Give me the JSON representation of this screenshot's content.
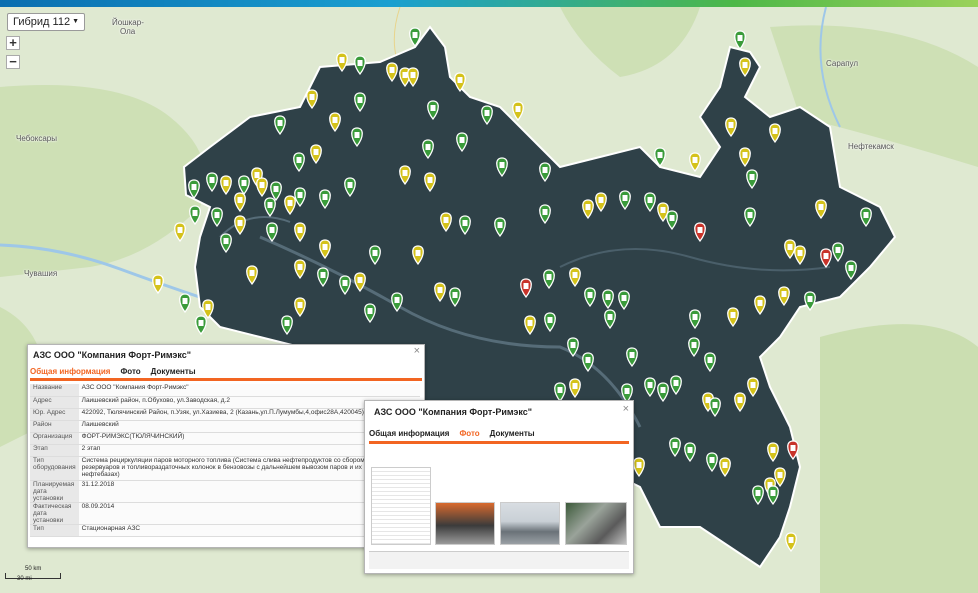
{
  "map": {
    "layer_select": "Гибрид 112",
    "zoom_in": "+",
    "zoom_out": "−",
    "labels": {
      "cheboksary": "Чебоксары",
      "yoshkar_ola_1": "Йошкар-",
      "yoshkar_ola_2": "Ола",
      "sarapul": "Сарапул",
      "neftekamsk": "Нефтекамск",
      "chuvashia": "Чувашия"
    },
    "scale": {
      "km": "50 km",
      "mi": "30 mi"
    },
    "colors": {
      "green": "#3a9b3a",
      "yellow": "#d4c21a",
      "grey": "#6e6e6e",
      "red": "#c8332a",
      "region": "#2f4148",
      "land": "#dfe9d1"
    }
  },
  "popup1": {
    "title": "АЗС ООО \"Компания Форт-Римэкс\"",
    "close": "×",
    "tabs": [
      "Общая информация",
      "Фото",
      "Документы"
    ],
    "rows": [
      {
        "k": "Название",
        "v": "АЗС ООО \"Компания Форт-Римэкс\""
      },
      {
        "k": "Адрес",
        "v": "Лаишевский район, п.Обухово, ул.Заводская, д.2"
      },
      {
        "k": "Юр. Адрес",
        "v": "422092, Тюлячинский Район, п.Узяк, ул.Хазиева, 2 (Казань,ул.П.Лумумбы,4,офис28А,420045)"
      },
      {
        "k": "Район",
        "v": "Лаишевский"
      },
      {
        "k": "Организация",
        "v": "ФОРТ-РИМЭКС(ТЮЛЯЧИНСКИЙ)"
      },
      {
        "k": "Этап",
        "v": "2 этап"
      },
      {
        "k": "Тип оборудования",
        "v": "Система рециркуляции паров моторного топлива (Система слива нефтепродуктов со сбором паров резервуаров и топливораздаточных колонок в бензовозы с дальнейшем вывозом паров и их рекуле нефтебазах)"
      },
      {
        "k": "Планируемая дата установки",
        "v": "31.12.2018"
      },
      {
        "k": "Фактическая дата установки",
        "v": "08.09.2014"
      },
      {
        "k": "Тип",
        "v": "Стационарная АЗС"
      }
    ]
  },
  "popup2": {
    "title": "АЗС ООО \"Компания Форт-Римэкс\"",
    "close": "×",
    "tabs": [
      "Общая информация",
      "Фото",
      "Документы"
    ],
    "photos": [
      "document-scan-icon",
      "tanker-truck-photo",
      "fuel-station-photo",
      "fuel-nozzle-photo"
    ]
  }
}
